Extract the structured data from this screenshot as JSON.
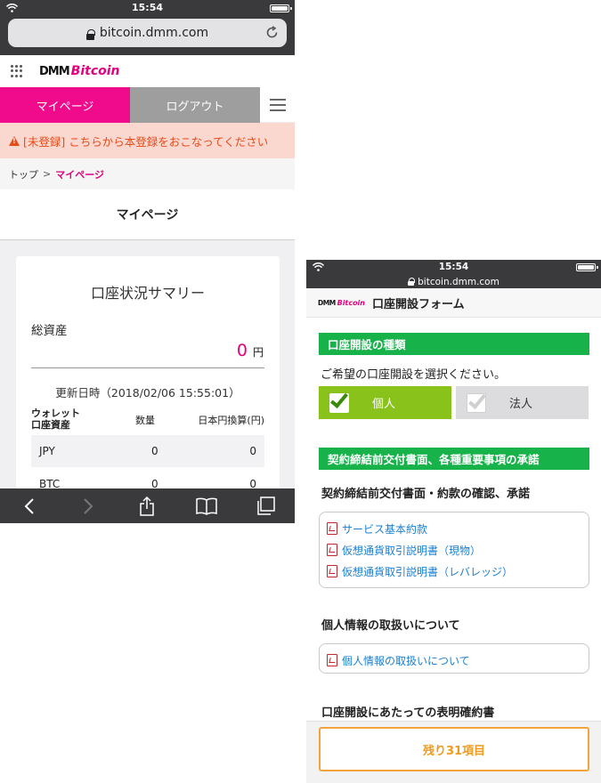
{
  "left": {
    "status": {
      "time": "15:54"
    },
    "url": "bitcoin.dmm.com",
    "brand": {
      "dmm": "DMM",
      "bitcoin": "Bitcoin"
    },
    "nav": {
      "mypage": "マイページ",
      "logout": "ログアウト"
    },
    "alert": "[未登録] こちらから本登録をおこなってください",
    "breadcrumb": {
      "home": "トップ",
      "sep": ">",
      "current": "マイページ"
    },
    "page_title": "マイページ",
    "summary": {
      "title": "口座状況サマリー",
      "asset_label": "総資産",
      "asset_value": "0",
      "asset_unit": "円",
      "updated": "更新日時（2018/02/06 15:55:01）",
      "headers": {
        "wallet_line1": "ウォレット",
        "wallet_line2": "口座資産",
        "qty": "数量",
        "jpy": "日本円換算(円)"
      },
      "rows": [
        {
          "name": "JPY",
          "qty": "0",
          "jpy": "0"
        },
        {
          "name": "BTC",
          "qty": "0",
          "jpy": "0"
        }
      ]
    },
    "icons": [
      "back-icon",
      "forward-icon",
      "share-icon",
      "bookmarks-icon",
      "tabs-icon"
    ]
  },
  "right": {
    "status": {
      "time": "15:54"
    },
    "url": "bitcoin.dmm.com",
    "brand": {
      "dmm": "DMM",
      "bitcoin": "Bitcoin"
    },
    "form_title": "口座開設フォーム",
    "section1": "口座開設の種類",
    "prompt": "ご希望の口座開設を選択ください。",
    "choices": {
      "personal": "個人",
      "corporate": "法人"
    },
    "section2": "契約締結前交付書面、各種重要事項の承諾",
    "sub1": "契約締結前交付書面・約款の確認、承諾",
    "docs1": [
      "サービス基本約款",
      "仮想通貨取引説明書（現物）",
      "仮想通貨取引説明書（レバレッジ）"
    ],
    "sub2": "個人情報の取扱いについて",
    "docs2": [
      "個人情報の取扱いについて"
    ],
    "sub3": "口座開設にあたっての表明確約書",
    "remaining": "残り31項目"
  },
  "colors": {
    "brand_pink": "#e4007f",
    "nav_pink": "#f00a8c",
    "alert_text": "#e84a18",
    "alert_bg": "#fbd8cf",
    "section_green": "#18b24b",
    "selected_green": "#88c21b",
    "link_blue": "#1a7fd2",
    "remaining_orange": "#f3a43c"
  }
}
